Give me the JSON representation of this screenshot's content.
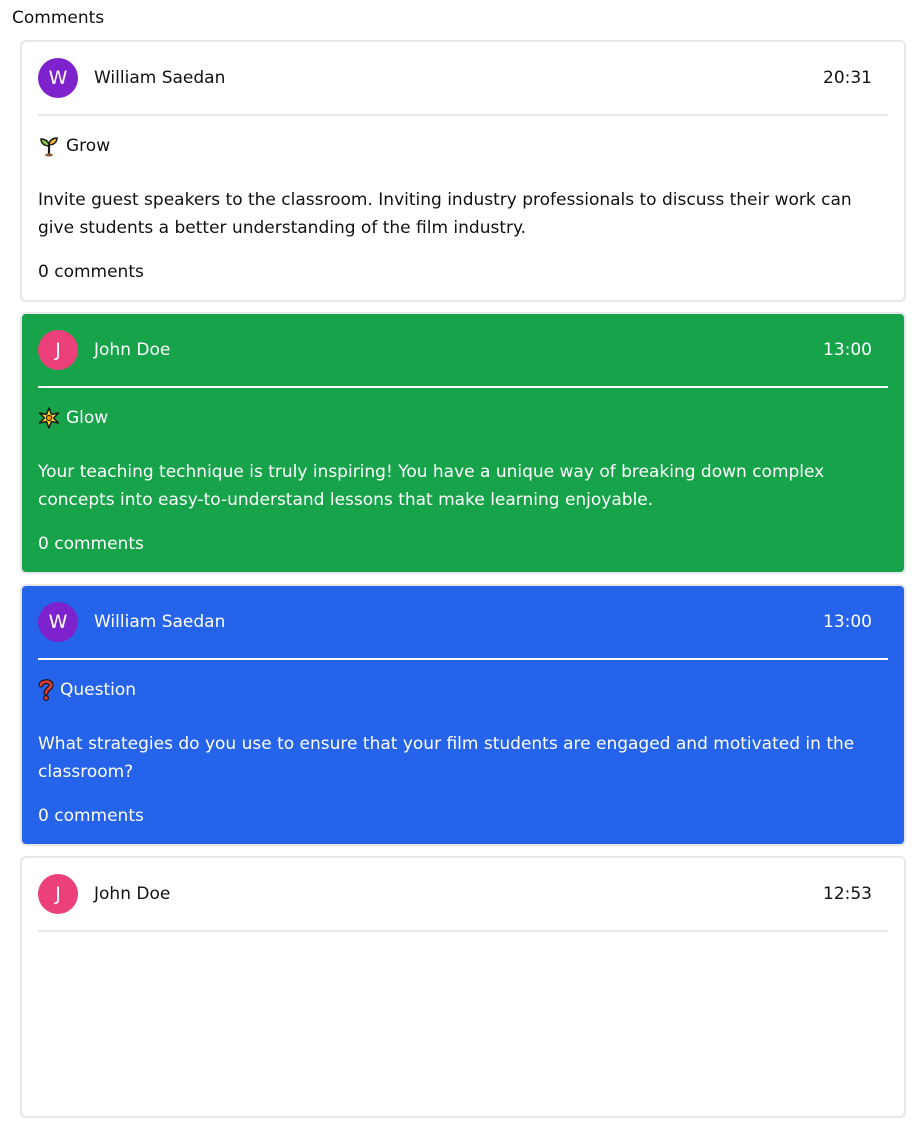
{
  "page": {
    "heading": "Comments"
  },
  "cards": [
    {
      "author": "William Saedan",
      "avatar_letter": "W",
      "avatar_color": "#7e22ce",
      "time": "20:31",
      "type_label": "Grow",
      "type_icon": "sprout-icon",
      "body": "Invite guest speakers to the classroom. Inviting industry professionals to discuss their work can give students a better understanding of the film industry.",
      "comments": "0 comments",
      "background": "#ffffff"
    },
    {
      "author": "John Doe",
      "avatar_letter": "J",
      "avatar_color": "#ec407a",
      "time": "13:00",
      "type_label": "Glow",
      "type_icon": "sparkle-star-icon",
      "body": "Your teaching technique is truly inspiring! You have a unique way of breaking down complex concepts into easy-to-understand lessons that make learning enjoyable.",
      "comments": "0 comments",
      "background": "#16a34a"
    },
    {
      "author": "William Saedan",
      "avatar_letter": "W",
      "avatar_color": "#7e22ce",
      "time": "13:00",
      "type_label": "Question",
      "type_icon": "question-mark-icon",
      "body": "What strategies do you use to ensure that your film students are engaged and motivated in the classroom?",
      "comments": "0 comments",
      "background": "#2563eb"
    },
    {
      "author": "John Doe",
      "avatar_letter": "J",
      "avatar_color": "#ec407a",
      "time": "12:53",
      "background": "#ffffff"
    }
  ]
}
